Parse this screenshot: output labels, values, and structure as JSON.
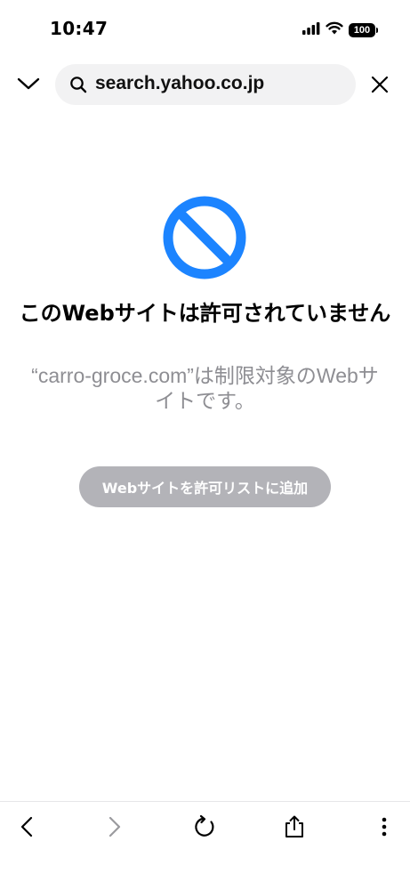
{
  "status_bar": {
    "time": "10:47",
    "battery": "100"
  },
  "address_bar": {
    "url": "search.yahoo.co.jp"
  },
  "blocked_page": {
    "title": "このWebサイトは許可されていません",
    "description": "“carro-groce.com”は制限対象のWebサイトです。",
    "allow_button_label": "Webサイトを許可リストに追加",
    "icon_color": "#1c84ff"
  },
  "toolbar": {
    "icons": [
      "back-icon",
      "forward-icon",
      "reload-icon",
      "share-icon",
      "more-icon"
    ]
  }
}
